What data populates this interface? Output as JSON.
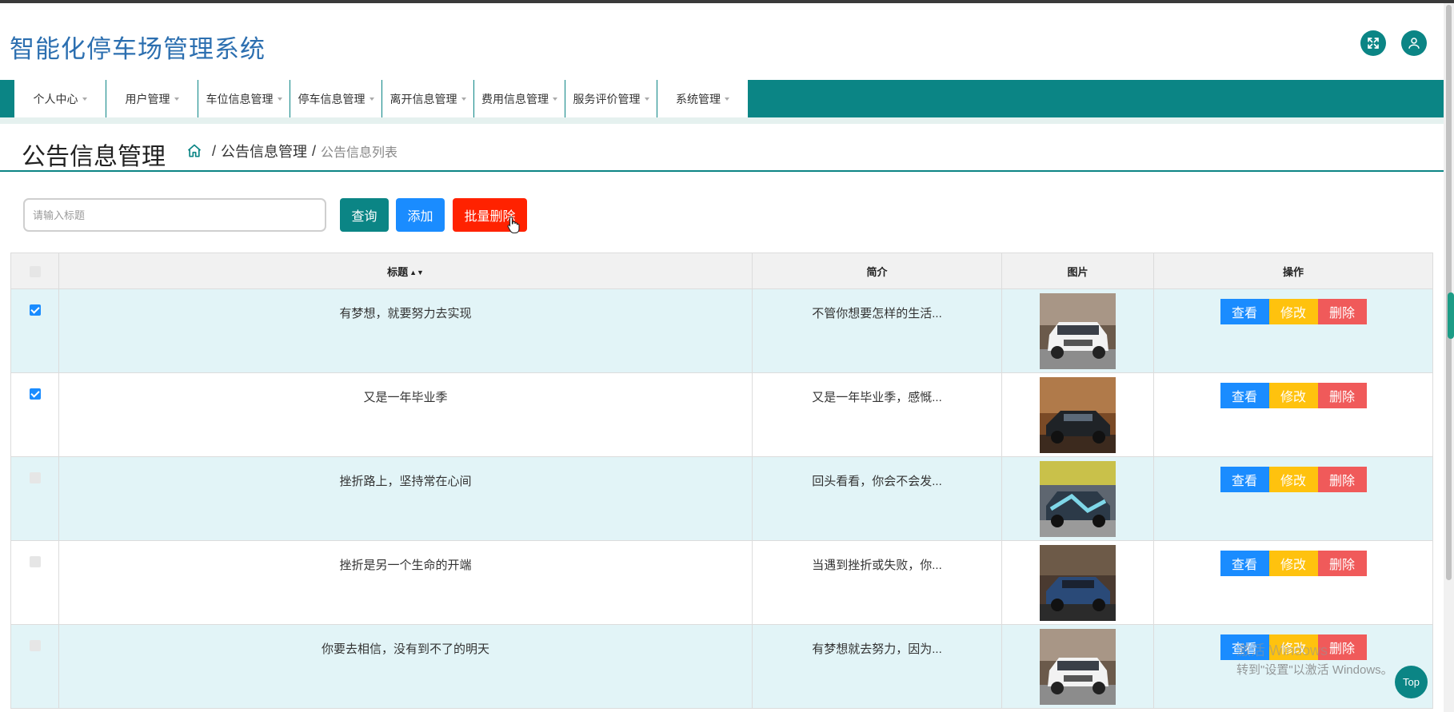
{
  "app": {
    "title": "智能化停车场管理系统"
  },
  "header_icons": {
    "fullscreen": "expand-icon",
    "user": "user-icon"
  },
  "nav": {
    "items": [
      {
        "label": "个人中心"
      },
      {
        "label": "用户管理"
      },
      {
        "label": "车位信息管理"
      },
      {
        "label": "停车信息管理"
      },
      {
        "label": "离开信息管理"
      },
      {
        "label": "费用信息管理"
      },
      {
        "label": "服务评价管理"
      },
      {
        "label": "系统管理"
      }
    ]
  },
  "page": {
    "title": "公告信息管理",
    "breadcrumb": {
      "sep1": "/",
      "section": "公告信息管理",
      "sep2": "/",
      "current": "公告信息列表"
    }
  },
  "toolbar": {
    "search_placeholder": "请输入标题",
    "search_value": "",
    "query_label": "查询",
    "add_label": "添加",
    "batch_delete_label": "批量删除"
  },
  "table": {
    "headers": {
      "title": "标题",
      "intro": "简介",
      "image": "图片",
      "actions": "操作"
    },
    "sort_icon": "sort-icon",
    "rows": [
      {
        "checked": true,
        "title": "有梦想，就要努力去实现",
        "intro": "不管你想要怎样的生活...",
        "image": "white-suv"
      },
      {
        "checked": true,
        "title": "又是一年毕业季",
        "intro": "又是一年毕业季，感慨...",
        "image": "dark-sports-car"
      },
      {
        "checked": false,
        "title": "挫折路上，坚持常在心间",
        "intro": "回头看看，你会不会发...",
        "image": "wrapped-car"
      },
      {
        "checked": false,
        "title": "挫折是另一个生命的开端",
        "intro": "当遇到挫折或失败，你...",
        "image": "blue-sedan"
      },
      {
        "checked": false,
        "title": "你要去相信，没有到不了的明天",
        "intro": "有梦想就去努力，因为...",
        "image": "white-suv"
      }
    ],
    "row_actions": {
      "view": "查看",
      "edit": "修改",
      "delete": "删除"
    }
  },
  "watermark": {
    "line1": "激活 Windows",
    "line2": "转到\"设置\"以激活 Windows。"
  },
  "back_to_top": "Top",
  "colors": {
    "primary": "#0b8585",
    "blue": "#1a8cff",
    "red": "#ff2200",
    "yellow": "#ffc20e",
    "title": "#2c6fb0"
  }
}
